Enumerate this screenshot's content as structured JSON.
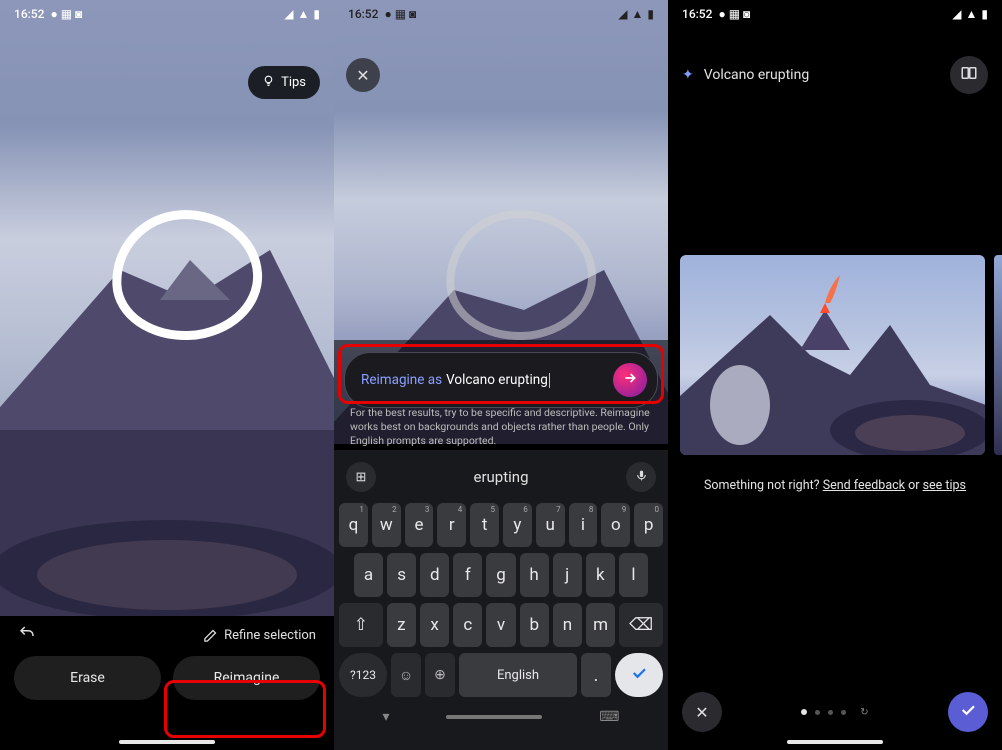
{
  "status": {
    "time": "16:52",
    "icons_left": [
      "chat-icon",
      "grid-icon",
      "camera-icon"
    ],
    "icons_right": [
      "wifi-icon",
      "signal-icon",
      "battery-icon"
    ]
  },
  "phone1": {
    "tips_label": "Tips",
    "refine_label": "Refine selection",
    "undo_name": "undo-icon",
    "erase_label": "Erase",
    "reimagine_label": "Reimagine"
  },
  "phone2": {
    "prompt_prefix": "Reimagine as",
    "prompt_value": "Volcano erupting",
    "hint": "For the best results, try to be specific and descriptive. Reimagine works best on backgrounds and objects rather than people. Only English prompts are supported.",
    "suggestion": "erupting",
    "keyboard": {
      "row1": [
        "q",
        "w",
        "e",
        "r",
        "t",
        "y",
        "u",
        "i",
        "o",
        "p"
      ],
      "hints1": [
        "1",
        "2",
        "3",
        "4",
        "5",
        "6",
        "7",
        "8",
        "9",
        "0"
      ],
      "row2": [
        "a",
        "s",
        "d",
        "f",
        "g",
        "h",
        "j",
        "k",
        "l"
      ],
      "row3": [
        "z",
        "x",
        "c",
        "v",
        "b",
        "n",
        "m"
      ],
      "shift_label": "⇧",
      "backspace_label": "⌫",
      "numeric_label": "?123",
      "space_label": "English",
      "period_label": "."
    }
  },
  "phone3": {
    "result_label": "Volcano erupting",
    "feedback_prefix": "Something not right? ",
    "send_feedback": "Send feedback",
    "or": " or ",
    "see_tips": "see tips",
    "pagination": {
      "current": 1,
      "total": 4
    }
  }
}
